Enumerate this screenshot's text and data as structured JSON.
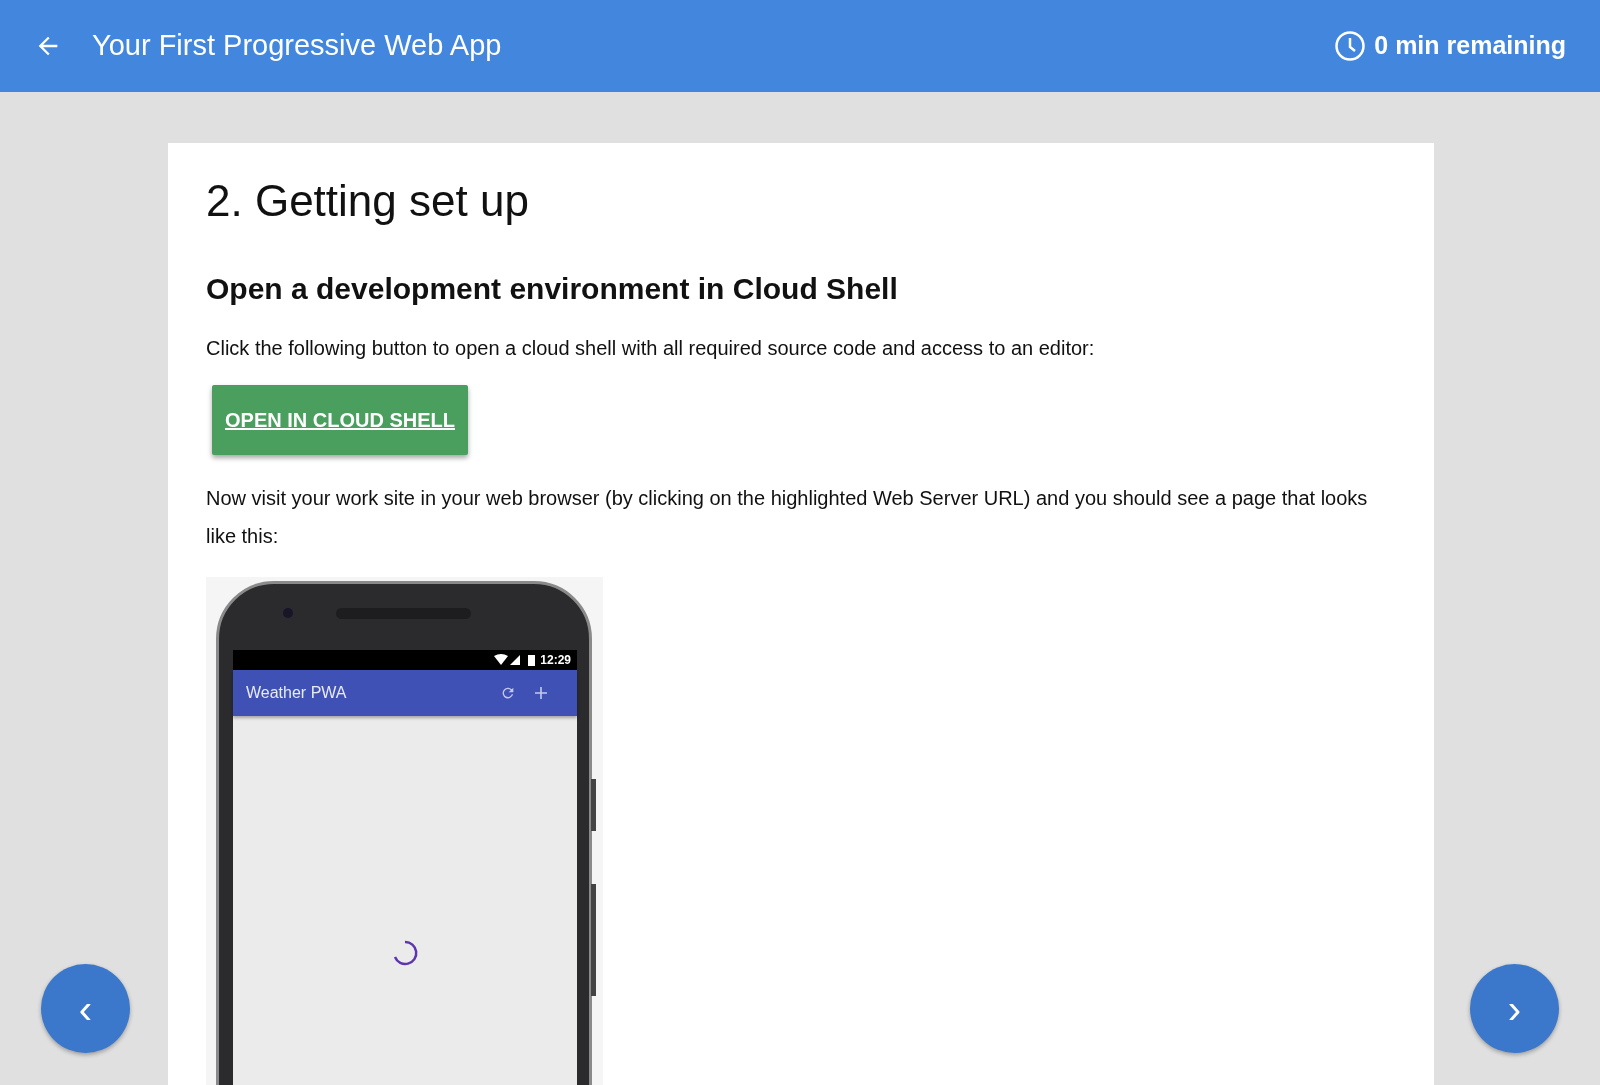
{
  "header": {
    "title": "Your First Progressive Web App",
    "time_remaining": "0 min remaining"
  },
  "content": {
    "title": "2. Getting set up",
    "subtitle": "Open a development environment in Cloud Shell",
    "paragraphs": [
      "Click the following button to open a cloud shell with all required source code and access to an editor:",
      "Now visit your work site in your web browser (by clicking on the highlighted Web Server URL) and you should see a page that looks like this:"
    ],
    "button": "OPEN IN CLOUD SHELL"
  },
  "phone": {
    "status_time": "12:29",
    "app_title": "Weather PWA"
  },
  "nav": {
    "previous": "‹",
    "next": "›"
  }
}
